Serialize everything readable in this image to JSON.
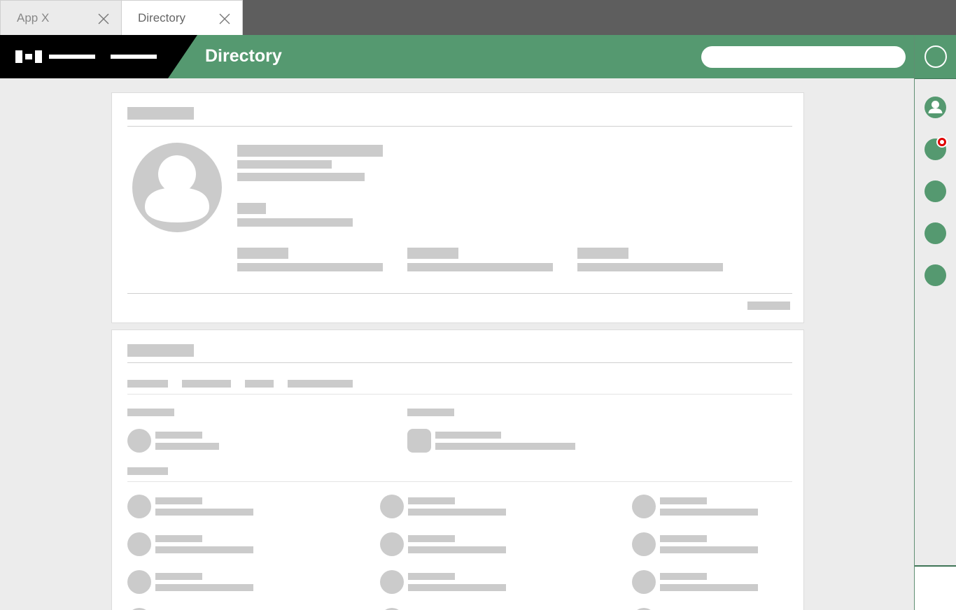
{
  "tabs": [
    {
      "label": "App X",
      "active": false
    },
    {
      "label": "Directory",
      "active": true
    }
  ],
  "header": {
    "title": "Directory",
    "search_placeholder": "",
    "accent_color": "#559970",
    "brand_color": "#000000"
  },
  "rail": {
    "items": [
      "account-icon",
      "notifications-icon",
      "apps-icon",
      "messages-icon",
      "help-icon"
    ],
    "badge_color": "#e00000"
  },
  "profile_card": {
    "placeholder_color": "#cbcbcb"
  },
  "organization_card": {
    "people_grid_rows": 4,
    "people_grid_cols": 3
  }
}
